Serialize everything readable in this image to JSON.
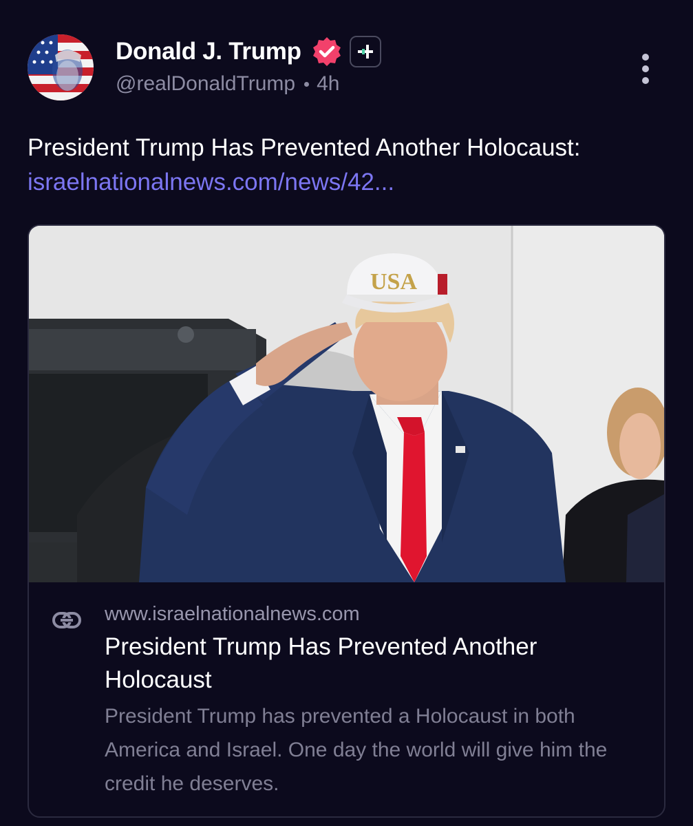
{
  "author": {
    "display_name": "Donald J. Trump",
    "handle": "@realDonaldTrump",
    "time_ago": "4h",
    "verified_icon": "verified-badge-icon",
    "badge_icon": "plus-badge-icon"
  },
  "post": {
    "text": "President Trump Has Prevented Another Holocaust:",
    "link_text": "israelnationalnews.com/news/42..."
  },
  "card": {
    "domain": "www.israelnationalnews.com",
    "title": "President Trump Has Prevented Another Holocaust",
    "description": "President Trump has prevented a Holocaust in both America and Israel. One day the world will give him the credit he deserves.",
    "image_cap_text": "USA"
  },
  "colors": {
    "background": "#0c0a1d",
    "link": "#7c76f2",
    "verified": "#f2416b",
    "muted_text": "#8d8ca3"
  }
}
